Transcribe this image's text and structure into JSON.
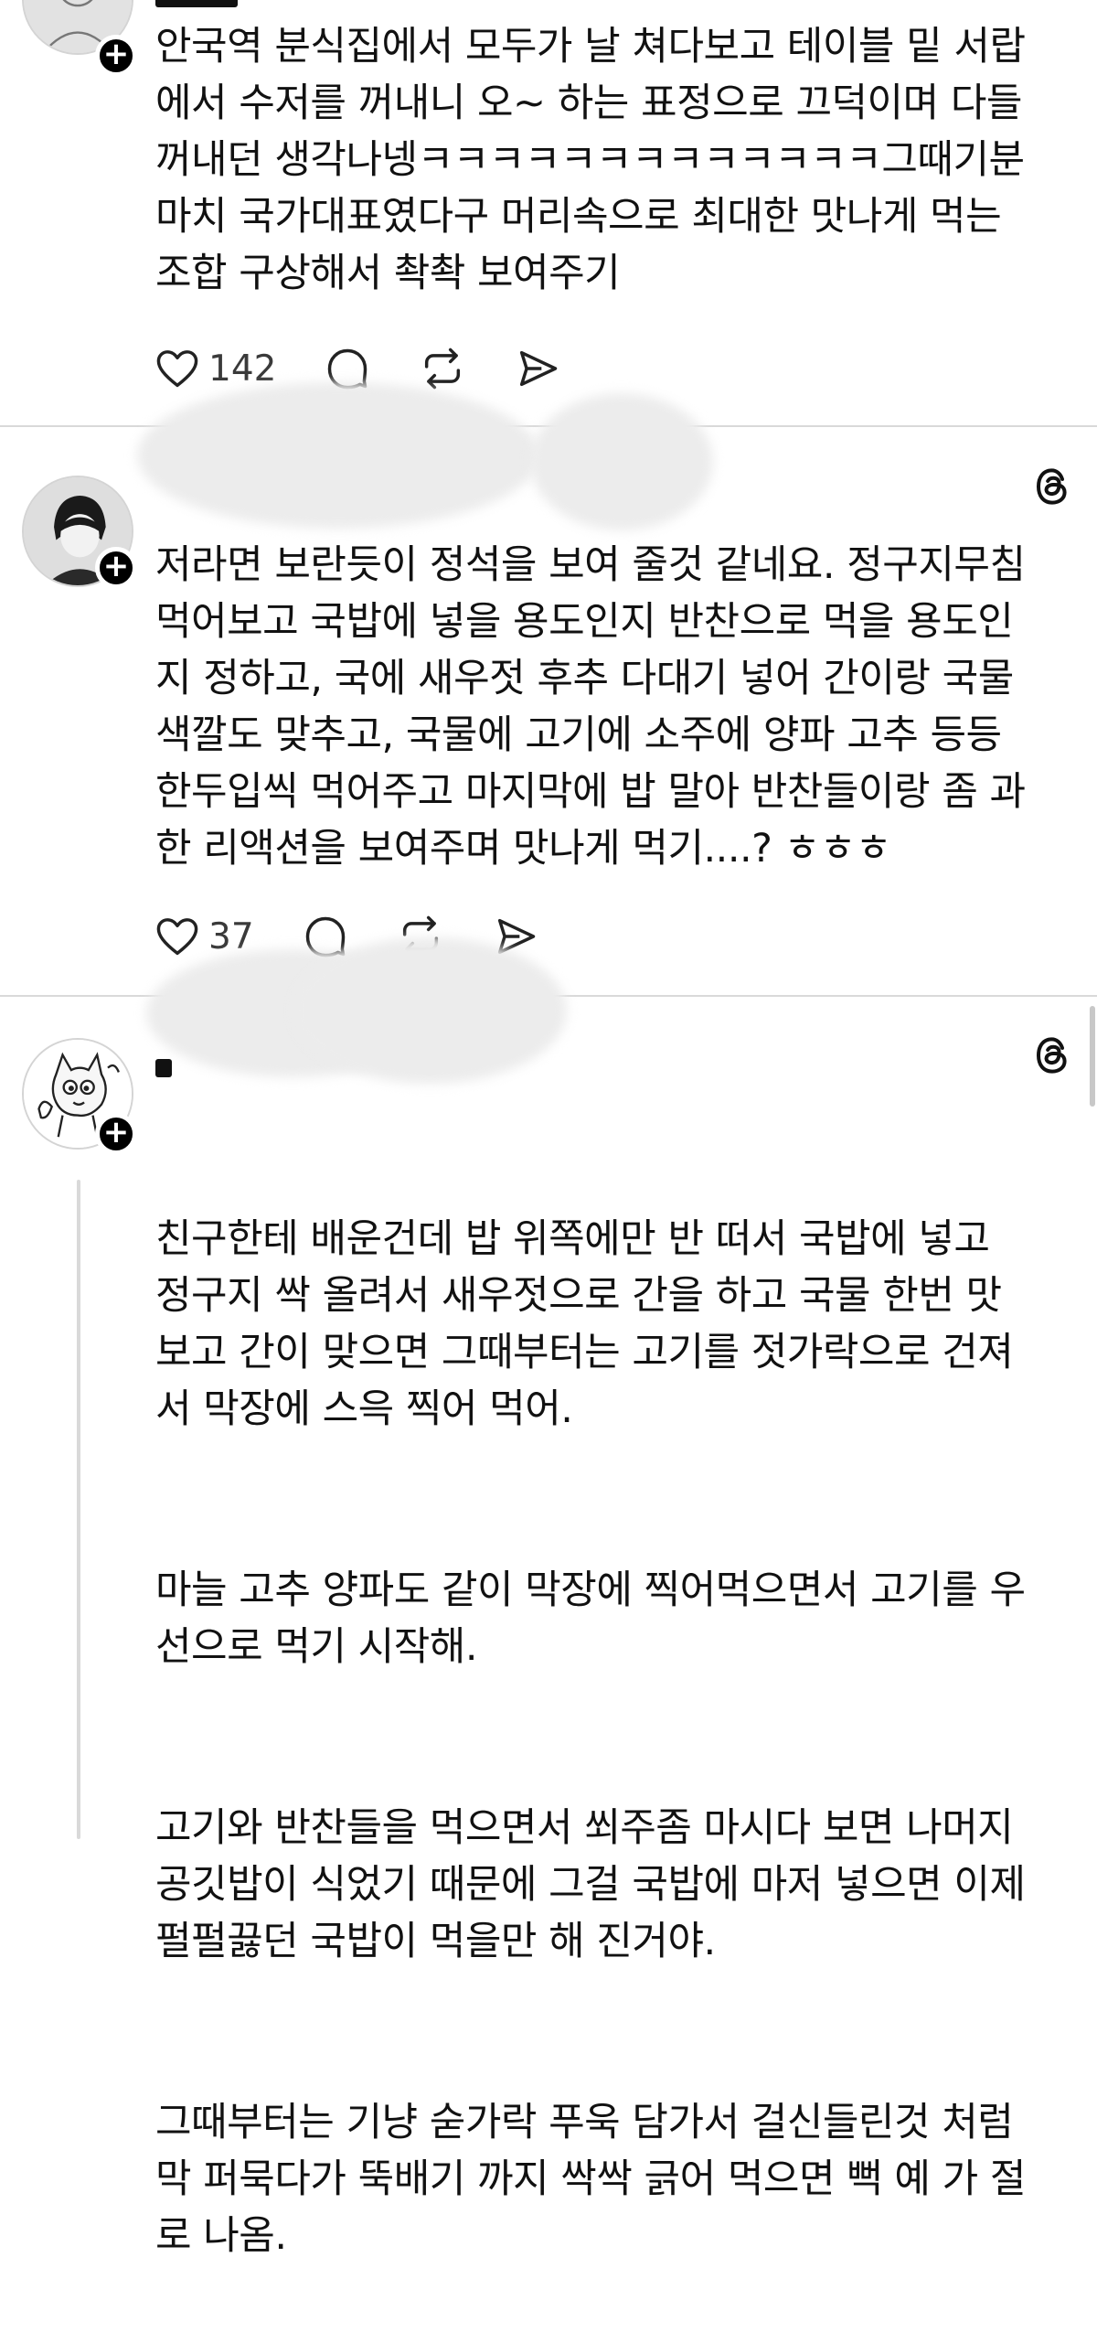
{
  "posts": [
    {
      "text": "안국역 분식집에서 모두가 날 쳐다보고 테이블 밑 서랍\n에서 수저를 꺼내니 오~ 하는 표정으로 끄덕이며 다들\n꺼내던 생각나넹ㅋㅋㅋㅋㅋㅋㅋㅋㅋㅋㅋㅋㅋ그때기분\n마치 국가대표였다구 머리속으로 최대한 맛나게 먹는\n조합 구상해서 촥촥 보여주기",
      "likes": "142",
      "icons": {
        "like": "heart-icon",
        "reply": "comment-icon",
        "repost": "repost-icon",
        "share": "share-icon"
      }
    },
    {
      "text": "저라면 보란듯이 정석을 보여 줄것 같네요. 정구지무침\n먹어보고 국밥에 넣을 용도인지 반찬으로 먹을 용도인\n지 정하고, 국에 새우젓 후추 다대기 넣어 간이랑 국물\n색깔도 맞추고, 국물에 고기에 소주에 양파 고추 등등\n한두입씩 먹어주고 마지막에 밥 말아 반찬들이랑 좀 과\n한 리액션을 보여주며 맛나게 먹기....? ㅎㅎㅎ",
      "likes": "37",
      "platform_icon": "threads-icon"
    },
    {
      "paragraphs": [
        "친구한테 배운건데 밥 위쪽에만 반 떠서 국밥에 넣고\n정구지 싹 올려서 새우젓으로 간을 하고 국물 한번 맛\n보고 간이 맞으면 그때부터는 고기를 젓가락으로 건져\n서 막장에 스윽 찍어 먹어.",
        "마늘 고추 양파도 같이 막장에 찍어먹으면서 고기를 우\n선으로 먹기 시작해.",
        "고기와 반찬들을 먹으면서 쐬주좀 마시다 보면 나머지\n공깃밥이 식었기 때문에 그걸 국밥에 마저 넣으면 이제\n펄펄끓던 국밥이 먹을만 해 진거야.",
        "그때부터는 기냥 숟가락 푸욱 담가서 걸신들린것 처럼\n막 퍼묵다가 뚝배기 까지 싹싹 긁어 먹으면 뻑 예 가 절\n로 나옴."
      ],
      "platform_icon": "threads-icon"
    }
  ],
  "colors": {
    "text": "#111111",
    "divider": "#d9d9d9",
    "badge": "#000000",
    "count": "#3a3a3a"
  }
}
